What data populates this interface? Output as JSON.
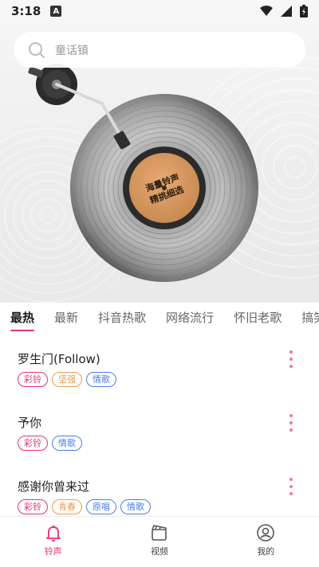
{
  "status_bar": {
    "time": "3:18",
    "badge": "A"
  },
  "search": {
    "placeholder": "童话镇"
  },
  "album_label": {
    "line1": "海量铃声",
    "line2": "精挑细选"
  },
  "tabs": [
    {
      "label": "最热",
      "active": true
    },
    {
      "label": "最新"
    },
    {
      "label": "抖音热歌"
    },
    {
      "label": "网络流行"
    },
    {
      "label": "怀旧老歌"
    },
    {
      "label": "搞笑"
    }
  ],
  "songs": [
    {
      "title": "罗生门(Follow)",
      "tags": [
        "彩铃",
        "坚强",
        "情歌"
      ]
    },
    {
      "title": "予你",
      "tags": [
        "彩铃",
        "情歌"
      ]
    },
    {
      "title": "感谢你曾来过",
      "tags": [
        "彩铃",
        "青春",
        "原唱",
        "情歌"
      ]
    }
  ],
  "tag_colors": {
    "彩铃": "#e8336b",
    "坚强": "#f29a4a",
    "情歌": "#4a7fe0",
    "青春": "#f29a4a",
    "原唱": "#4a7fe0"
  },
  "accent_color": "#e8336b",
  "bottom_nav": [
    {
      "label": "铃声",
      "icon": "bell-icon",
      "active": true
    },
    {
      "label": "视频",
      "icon": "video-clapper-icon"
    },
    {
      "label": "我的",
      "icon": "user-icon"
    }
  ]
}
